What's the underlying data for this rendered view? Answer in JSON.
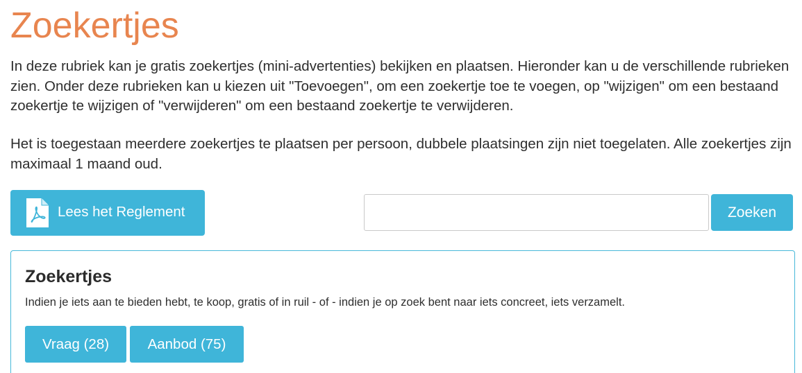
{
  "page": {
    "title": "Zoekertjes",
    "intro_paragraph_1": "In deze rubriek kan je gratis zoekertjes (mini-advertenties) bekijken en plaatsen. Hieronder kan u de verschillende rubrieken zien. Onder deze rubrieken kan u kiezen uit \"Toevoegen\", om een zoekertje toe te voegen, op \"wijzigen\" om een bestaand zoekertje te wijzigen of \"verwijderen\" om een bestaand zoekertje te verwijderen.",
    "intro_paragraph_2": "Het is toegestaan meerdere zoekertjes te plaatsen per persoon, dubbele plaatsingen zijn niet toegelaten. Alle zoekertjes zijn maximaal 1 maand oud."
  },
  "toolbar": {
    "reglement_label": "Lees het Reglement",
    "reglement_icon": "pdf-file-icon",
    "search_value": "",
    "search_placeholder": "",
    "search_button_label": "Zoeken"
  },
  "category_panel": {
    "title": "Zoekertjes",
    "description": "Indien je iets aan te bieden hebt, te koop, gratis of in ruil - of - indien je op zoek bent naar iets concreet, iets verzamelt.",
    "buttons": [
      {
        "label": "Vraag (28)"
      },
      {
        "label": "Aanbod (75)"
      }
    ]
  },
  "colors": {
    "title_accent": "#e8854f",
    "button_primary": "#3fb5d9",
    "panel_border": "#47b8d9",
    "text": "#2e2e2e"
  }
}
